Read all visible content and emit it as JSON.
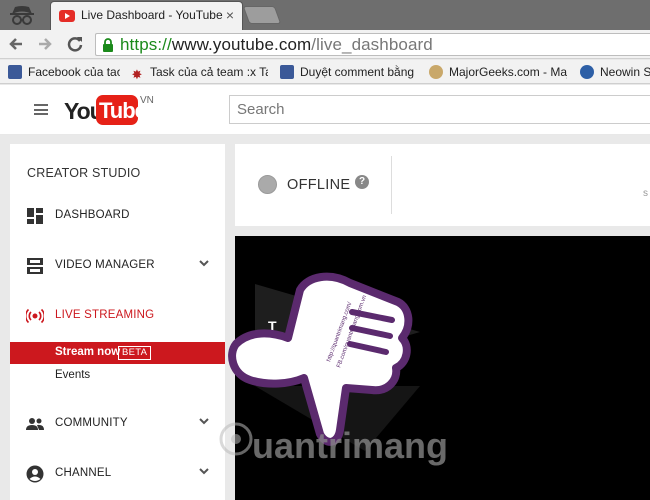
{
  "browser": {
    "tab_title": "Live Dashboard - YouTube",
    "tab_close": "×",
    "url_scheme": "https://",
    "url_host": "www.youtube.com",
    "url_path": "/live_dashboard",
    "bookmarks": [
      {
        "label": "Facebook của tao",
        "icon": "facebook-icon",
        "color": "#3b5998"
      },
      {
        "label": "Task của cả team :x Ta",
        "icon": "maple-leaf-icon",
        "color": "#b22222"
      },
      {
        "label": "Duyệt comment bằng ph",
        "icon": "facebook-icon",
        "color": "#3b5998"
      },
      {
        "label": "MajorGeeks.com - Major",
        "icon": "majorgeeks-icon",
        "color": "#8a6d3b"
      },
      {
        "label": "Neowin Sof",
        "icon": "neowin-icon",
        "color": "#2d5fa6"
      }
    ]
  },
  "header": {
    "logo_you": "You",
    "logo_tube": "Tube",
    "logo_region": "VN",
    "search_placeholder": "Search"
  },
  "sidebar": {
    "heading": "CREATOR STUDIO",
    "items": [
      {
        "label": "DASHBOARD",
        "icon": "dashboard-icon"
      },
      {
        "label": "VIDEO MANAGER",
        "icon": "video-manager-icon"
      },
      {
        "label": "LIVE STREAMING",
        "icon": "live-streaming-icon"
      },
      {
        "label": "COMMUNITY",
        "icon": "community-icon"
      },
      {
        "label": "CHANNEL",
        "icon": "channel-icon"
      }
    ],
    "live_sub": [
      {
        "label": "Stream now",
        "badge": "BETA"
      },
      {
        "label": "Events"
      }
    ]
  },
  "main": {
    "status": "OFFLINE",
    "help": "?",
    "edge_text": "s",
    "player_text": "T"
  },
  "overlay": {
    "watermark_text": "uantrimang",
    "watermark_url_1": "http://quantrimang.com/",
    "watermark_url_2": "FB.com/quantrimang.com.vn"
  },
  "colors": {
    "brand_red": "#cc181e",
    "youtube_red": "#e62117",
    "secure_green": "#1b8a1b",
    "watermark_purple": "#5b2a6e"
  }
}
